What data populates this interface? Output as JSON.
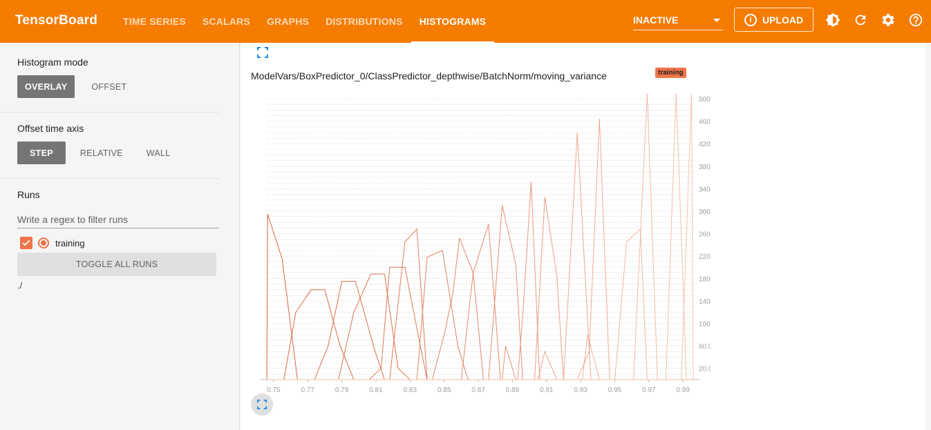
{
  "header": {
    "brand": "TensorBoard",
    "tabs": [
      {
        "label": "TIME SERIES",
        "active": false
      },
      {
        "label": "SCALARS",
        "active": false
      },
      {
        "label": "GRAPHS",
        "active": false
      },
      {
        "label": "DISTRIBUTIONS",
        "active": false
      },
      {
        "label": "HISTOGRAMS",
        "active": true
      }
    ],
    "status_select": "INACTIVE",
    "upload_label": "UPLOAD",
    "icons": [
      "brightness-icon",
      "refresh-icon",
      "settings-icon",
      "help-icon"
    ]
  },
  "sidebar": {
    "histogram_mode": {
      "title": "Histogram mode",
      "options": [
        "OVERLAY",
        "OFFSET"
      ],
      "selected": "OVERLAY"
    },
    "offset_time_axis": {
      "title": "Offset time axis",
      "options": [
        "STEP",
        "RELATIVE",
        "WALL"
      ],
      "selected": "STEP"
    },
    "runs": {
      "title": "Runs",
      "filter_placeholder": "Write a regex to filter runs",
      "items": [
        {
          "name": "training",
          "checked": true
        }
      ],
      "toggle_label": "TOGGLE ALL RUNS",
      "log_dir": "./"
    }
  },
  "main": {
    "chart_title": "ModelVars/BoxPredictor_0/ClassPredictor_depthwise/BatchNorm/moving_variance",
    "run_badge": "training"
  },
  "colors": {
    "header": "#f57c00",
    "run": "#f0744a",
    "selected_button": "#757575"
  },
  "chart_data": {
    "type": "line",
    "mode": "overlay",
    "x_ticks": [
      "0.75",
      "0.77",
      "0.79",
      "0.81",
      "0.83",
      "0.85",
      "0.87",
      "0.89",
      "0.91",
      "0.93",
      "0.95",
      "0.97",
      "0.99"
    ],
    "y_ticks": [
      "20.0",
      "60.0",
      "100",
      "140",
      "180",
      "220",
      "260",
      "300",
      "340",
      "380",
      "420",
      "460",
      "500"
    ],
    "xlim": [
      0.746,
      0.996
    ],
    "ylim": [
      0,
      510
    ],
    "y_axis_side": "right",
    "grid": "horizontal-dashed",
    "series": [
      {
        "values": [
          [
            0.746,
            0
          ],
          [
            0.7465,
            295
          ],
          [
            0.755,
            215
          ],
          [
            0.764,
            0
          ],
          [
            0.996,
            0
          ]
        ]
      },
      {
        "values": [
          [
            0.746,
            0
          ],
          [
            0.756,
            0
          ],
          [
            0.763,
            120
          ],
          [
            0.772,
            160
          ],
          [
            0.78,
            160
          ],
          [
            0.789,
            60
          ],
          [
            0.797,
            0
          ],
          [
            0.996,
            0
          ]
        ]
      },
      {
        "values": [
          [
            0.746,
            0
          ],
          [
            0.774,
            0
          ],
          [
            0.782,
            60
          ],
          [
            0.79,
            175
          ],
          [
            0.798,
            175
          ],
          [
            0.809,
            55
          ],
          [
            0.815,
            0
          ],
          [
            0.996,
            0
          ]
        ]
      },
      {
        "values": [
          [
            0.746,
            0
          ],
          [
            0.788,
            0
          ],
          [
            0.797,
            120
          ],
          [
            0.807,
            188
          ],
          [
            0.815,
            188
          ],
          [
            0.823,
            20
          ],
          [
            0.83,
            0
          ],
          [
            0.996,
            0
          ]
        ]
      },
      {
        "values": [
          [
            0.746,
            0
          ],
          [
            0.806,
            0
          ],
          [
            0.813,
            20
          ],
          [
            0.818,
            200
          ],
          [
            0.827,
            200
          ],
          [
            0.836,
            60
          ],
          [
            0.84,
            0
          ],
          [
            0.996,
            0
          ]
        ]
      },
      {
        "values": [
          [
            0.746,
            0
          ],
          [
            0.818,
            0
          ],
          [
            0.827,
            245
          ],
          [
            0.834,
            268
          ],
          [
            0.84,
            0
          ],
          [
            0.996,
            0
          ]
        ]
      },
      {
        "values": [
          [
            0.746,
            0
          ],
          [
            0.834,
            0
          ],
          [
            0.84,
            218
          ],
          [
            0.849,
            230
          ],
          [
            0.858,
            60
          ],
          [
            0.864,
            0
          ],
          [
            0.996,
            0
          ]
        ]
      },
      {
        "values": [
          [
            0.746,
            0
          ],
          [
            0.843,
            0
          ],
          [
            0.85,
            80
          ],
          [
            0.855,
            152
          ],
          [
            0.859,
            252
          ],
          [
            0.867,
            190
          ],
          [
            0.873,
            0
          ],
          [
            0.996,
            0
          ]
        ]
      },
      {
        "values": [
          [
            0.746,
            0
          ],
          [
            0.86,
            0
          ],
          [
            0.867,
            190
          ],
          [
            0.876,
            277
          ],
          [
            0.883,
            0
          ],
          [
            0.996,
            0
          ]
        ]
      },
      {
        "values": [
          [
            0.746,
            0
          ],
          [
            0.876,
            0
          ],
          [
            0.884,
            310
          ],
          [
            0.892,
            205
          ],
          [
            0.896,
            0
          ],
          [
            0.996,
            0
          ]
        ]
      },
      {
        "values": [
          [
            0.746,
            0
          ],
          [
            0.884,
            0
          ],
          [
            0.886,
            60
          ],
          [
            0.892,
            0
          ],
          [
            0.996,
            0
          ]
        ]
      },
      {
        "values": [
          [
            0.746,
            0
          ],
          [
            0.893,
            0
          ],
          [
            0.896,
            110
          ],
          [
            0.901,
            352
          ],
          [
            0.906,
            0
          ],
          [
            0.996,
            0
          ]
        ]
      },
      {
        "values": [
          [
            0.746,
            0
          ],
          [
            0.903,
            0
          ],
          [
            0.909,
            325
          ],
          [
            0.916,
            185
          ],
          [
            0.92,
            0
          ],
          [
            0.996,
            0
          ]
        ]
      },
      {
        "values": [
          [
            0.746,
            0
          ],
          [
            0.905,
            0
          ],
          [
            0.909,
            50
          ],
          [
            0.916,
            0
          ],
          [
            0.996,
            0
          ]
        ]
      },
      {
        "values": [
          [
            0.746,
            0
          ],
          [
            0.92,
            0
          ],
          [
            0.928,
            440
          ],
          [
            0.936,
            0
          ],
          [
            0.996,
            0
          ]
        ]
      },
      {
        "values": [
          [
            0.746,
            0
          ],
          [
            0.928,
            0
          ],
          [
            0.935,
            50
          ],
          [
            0.941,
            465
          ],
          [
            0.947,
            0
          ],
          [
            0.996,
            0
          ]
        ]
      },
      {
        "values": [
          [
            0.746,
            0
          ],
          [
            0.931,
            0
          ],
          [
            0.934,
            80
          ],
          [
            0.941,
            0
          ],
          [
            0.996,
            0
          ]
        ]
      },
      {
        "values": [
          [
            0.746,
            0
          ],
          [
            0.95,
            0
          ],
          [
            0.957,
            245
          ],
          [
            0.965,
            268
          ],
          [
            0.969,
            0
          ],
          [
            0.996,
            0
          ]
        ]
      },
      {
        "values": [
          [
            0.746,
            0
          ],
          [
            0.961,
            0
          ],
          [
            0.969,
            510
          ],
          [
            0.975,
            0
          ],
          [
            0.996,
            0
          ]
        ]
      },
      {
        "values": [
          [
            0.746,
            0
          ],
          [
            0.98,
            0
          ],
          [
            0.986,
            510
          ],
          [
            0.992,
            0
          ],
          [
            0.996,
            0
          ]
        ]
      },
      {
        "values": [
          [
            0.746,
            0
          ],
          [
            0.989,
            0
          ],
          [
            0.995,
            510
          ],
          [
            0.996,
            0
          ]
        ]
      }
    ]
  }
}
